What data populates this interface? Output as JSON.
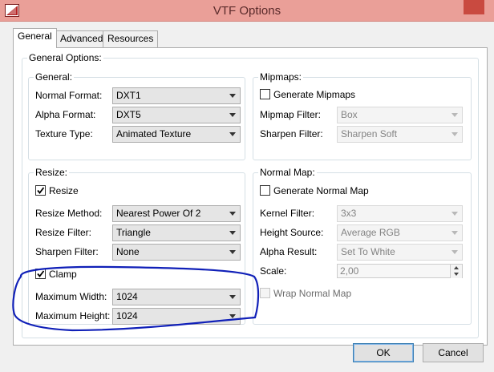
{
  "window": {
    "title": "VTF Options"
  },
  "tabs": [
    {
      "label": "General",
      "active": true
    },
    {
      "label": "Advanced",
      "active": false
    },
    {
      "label": "Resources",
      "active": false
    }
  ],
  "general_options": {
    "title": "General Options:",
    "general": {
      "title": "General:",
      "normal_format": {
        "label": "Normal Format:",
        "value": "DXT1"
      },
      "alpha_format": {
        "label": "Alpha Format:",
        "value": "DXT5"
      },
      "texture_type": {
        "label": "Texture Type:",
        "value": "Animated Texture"
      }
    },
    "mipmaps": {
      "title": "Mipmaps:",
      "generate": {
        "label": "Generate Mipmaps",
        "checked": false
      },
      "mipmap_filter": {
        "label": "Mipmap Filter:",
        "value": "Box"
      },
      "sharpen_filter": {
        "label": "Sharpen Filter:",
        "value": "Sharpen Soft"
      }
    },
    "resize": {
      "title": "Resize:",
      "resize_check": {
        "label": "Resize",
        "checked": true
      },
      "resize_method": {
        "label": "Resize Method:",
        "value": "Nearest Power Of 2"
      },
      "resize_filter": {
        "label": "Resize Filter:",
        "value": "Triangle"
      },
      "sharpen_filter": {
        "label": "Sharpen Filter:",
        "value": "None"
      },
      "clamp": {
        "label": "Clamp",
        "checked": true
      },
      "max_width": {
        "label": "Maximum Width:",
        "value": "1024"
      },
      "max_height": {
        "label": "Maximum Height:",
        "value": "1024"
      }
    },
    "normal_map": {
      "title": "Normal Map:",
      "generate": {
        "label": "Generate Normal Map",
        "checked": false
      },
      "kernel_filter": {
        "label": "Kernel Filter:",
        "value": "3x3"
      },
      "height_source": {
        "label": "Height Source:",
        "value": "Average RGB"
      },
      "alpha_result": {
        "label": "Alpha Result:",
        "value": "Set To White"
      },
      "scale": {
        "label": "Scale:",
        "value": "2,00"
      },
      "wrap": {
        "label": "Wrap Normal Map",
        "checked": false
      }
    }
  },
  "buttons": {
    "ok": "OK",
    "cancel": "Cancel"
  },
  "colors": {
    "titlebar": "#ea9f98",
    "annotation_stroke": "#1020b8"
  }
}
